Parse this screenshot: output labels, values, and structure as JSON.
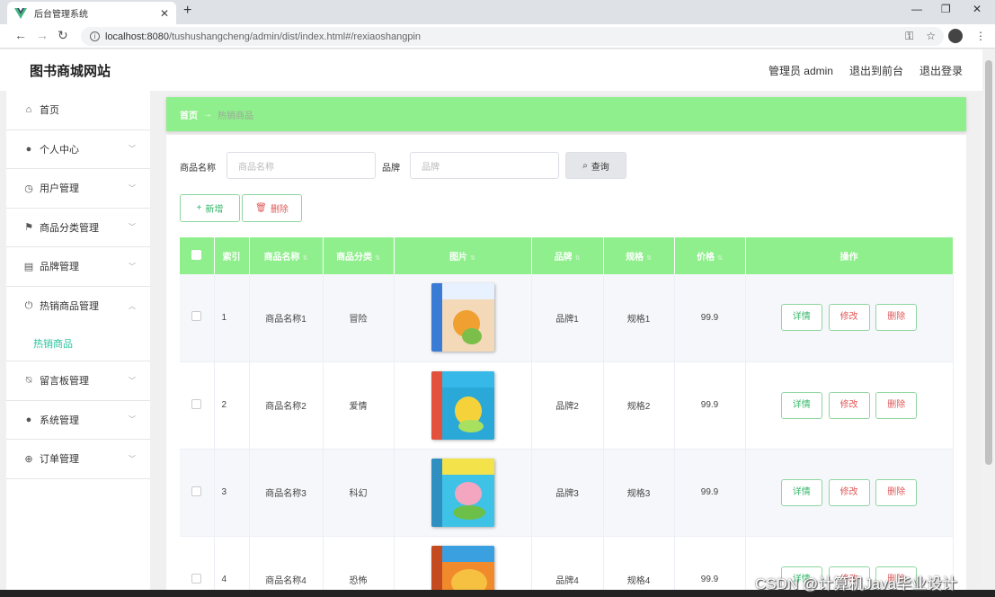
{
  "browser": {
    "tab_title": "后台管理系统",
    "url_host": "localhost:8080",
    "url_path": "/tushushangcheng/admin/dist/index.html#/rexiaoshangpin"
  },
  "header": {
    "site_title": "图书商城网站",
    "user": "管理员 admin",
    "to_front": "退出到前台",
    "logout": "退出登录"
  },
  "sidebar": {
    "items": [
      {
        "label": "首页",
        "icon": "home-icon"
      },
      {
        "label": "个人中心",
        "icon": "user-icon"
      },
      {
        "label": "用户管理",
        "icon": "clock-icon"
      },
      {
        "label": "商品分类管理",
        "icon": "flag-icon"
      },
      {
        "label": "品牌管理",
        "icon": "document-icon"
      },
      {
        "label": "热销商品管理",
        "icon": "power-icon"
      },
      {
        "label": "留言板管理",
        "icon": "bell-off-icon"
      },
      {
        "label": "系统管理",
        "icon": "user-icon"
      },
      {
        "label": "订单管理",
        "icon": "compass-icon"
      }
    ],
    "active_sub": "热销商品"
  },
  "breadcrumb": {
    "home": "首页",
    "current": "热销商品"
  },
  "search": {
    "name_label": "商品名称",
    "name_placeholder": "商品名称",
    "brand_label": "品牌",
    "brand_placeholder": "品牌",
    "query_label": "查询"
  },
  "actions": {
    "add_label": "新增",
    "delete_label": "删除"
  },
  "table": {
    "columns": [
      "索引",
      "商品名称",
      "商品分类",
      "图片",
      "品牌",
      "规格",
      "价格",
      "操作"
    ],
    "rows": [
      {
        "index": "1",
        "name": "商品名称1",
        "category": "冒险",
        "brand": "品牌1",
        "spec": "规格1",
        "price": "99.9"
      },
      {
        "index": "2",
        "name": "商品名称2",
        "category": "爱情",
        "brand": "品牌2",
        "spec": "规格2",
        "price": "99.9"
      },
      {
        "index": "3",
        "name": "商品名称3",
        "category": "科幻",
        "brand": "品牌3",
        "spec": "规格3",
        "price": "99.9"
      },
      {
        "index": "4",
        "name": "商品名称4",
        "category": "恐怖",
        "brand": "品牌4",
        "spec": "规格4",
        "price": "99.9"
      }
    ],
    "op_detail": "详情",
    "op_edit": "修改",
    "op_delete": "删除"
  },
  "colors": {
    "accent": "#8fef8c",
    "teal": "#2bc3a0",
    "danger": "#e05a5a"
  },
  "watermark": "CSDN @计算机Java毕业设计"
}
